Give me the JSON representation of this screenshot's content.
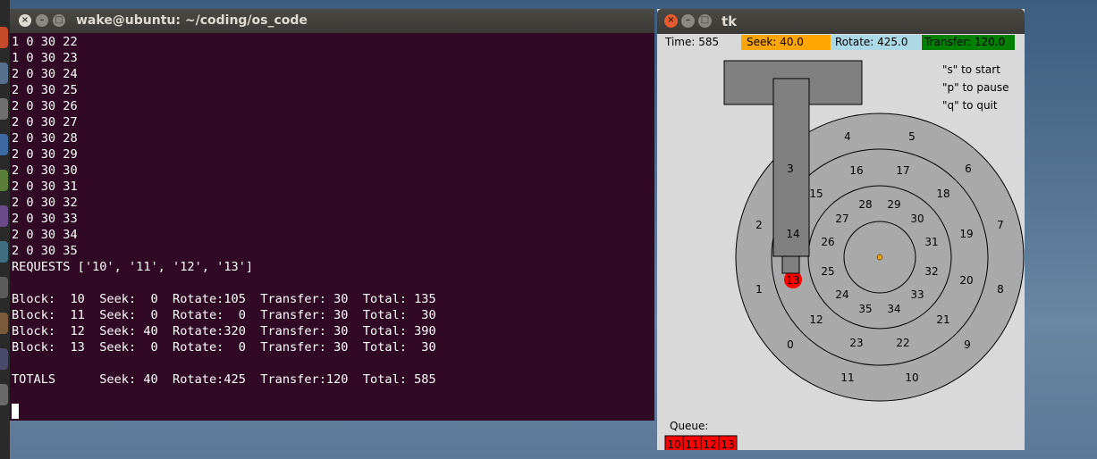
{
  "terminal": {
    "title": "wake@ubuntu: ~/coding/os_code",
    "lines": [
      "1 0 30 22",
      "1 0 30 23",
      "2 0 30 24",
      "2 0 30 25",
      "2 0 30 26",
      "2 0 30 27",
      "2 0 30 28",
      "2 0 30 29",
      "2 0 30 30",
      "2 0 30 31",
      "2 0 30 32",
      "2 0 30 33",
      "2 0 30 34",
      "2 0 30 35",
      "REQUESTS ['10', '11', '12', '13']",
      "",
      "Block:  10  Seek:  0  Rotate:105  Transfer: 30  Total: 135",
      "Block:  11  Seek:  0  Rotate:  0  Transfer: 30  Total:  30",
      "Block:  12  Seek: 40  Rotate:320  Transfer: 30  Total: 390",
      "Block:  13  Seek:  0  Rotate:  0  Transfer: 30  Total:  30",
      "",
      "TOTALS      Seek: 40  Rotate:425  Transfer:120  Total: 585"
    ]
  },
  "tk": {
    "title": "tk",
    "status": {
      "time": "Time: 585",
      "seek": "Seek: 40.0",
      "rotate": "Rotate: 425.0",
      "transfer": "Transfer: 120.0"
    },
    "help": [
      "\"s\" to start",
      "\"p\" to pause",
      "\"q\" to quit"
    ],
    "disk": {
      "outer": [
        "4",
        "5",
        "6",
        "7",
        "8",
        "9",
        "10",
        "11",
        "0",
        "1",
        "2",
        "3"
      ],
      "middle": [
        "16",
        "17",
        "18",
        "19",
        "20",
        "21",
        "22",
        "23",
        "12",
        "13",
        "14",
        "15"
      ],
      "inner": [
        "28",
        "29",
        "30",
        "31",
        "32",
        "33",
        "34",
        "35",
        "24",
        "25",
        "26",
        "27"
      ],
      "highlighted": "13"
    },
    "queue_label": "Queue:",
    "queue": [
      "10",
      "11",
      "12",
      "13"
    ]
  },
  "colors": {
    "terminal_bg": "#300a24",
    "seek_bg": "#ffa500",
    "rotate_bg": "#add8e6",
    "transfer_bg": "#008000",
    "platter": "#a9a9a9",
    "arm": "#808080",
    "highlight": "#ff0000"
  }
}
